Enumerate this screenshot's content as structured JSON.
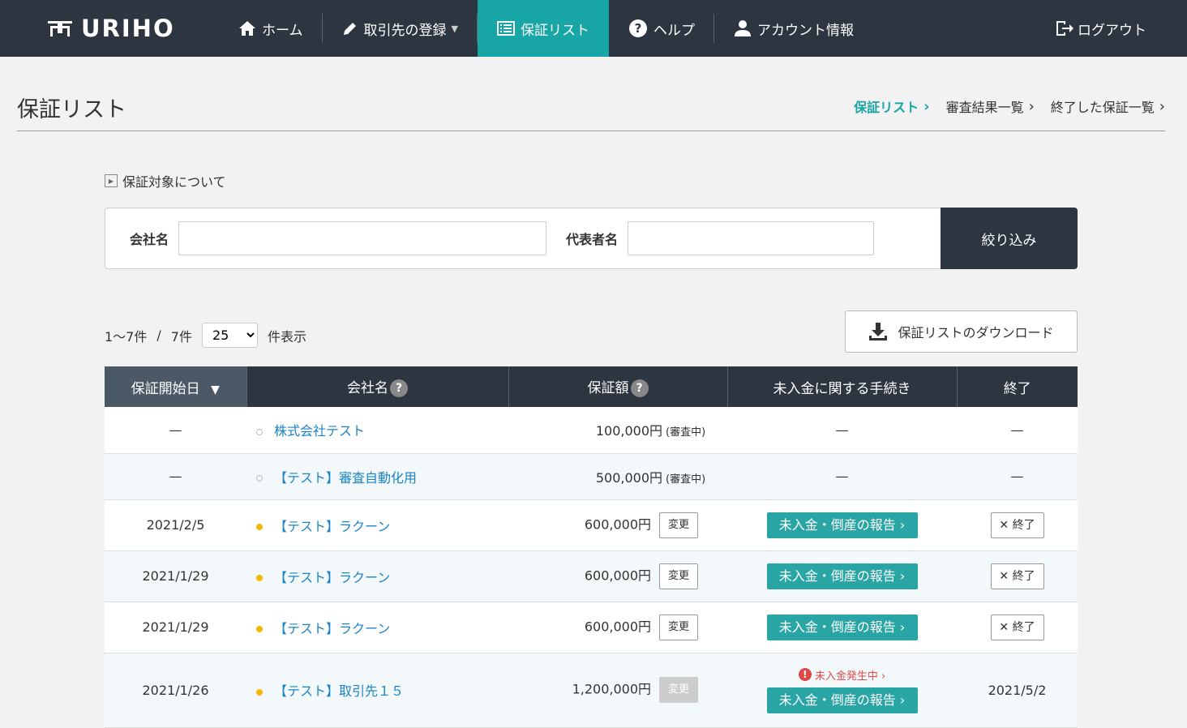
{
  "nav": {
    "logo": "URIHO",
    "items": [
      {
        "label": "ホーム"
      },
      {
        "label": "取引先の登録",
        "caret": "▼"
      },
      {
        "label": "保証リスト"
      },
      {
        "label": "ヘルプ"
      },
      {
        "label": "アカウント情報"
      }
    ],
    "logout": "ログアウト"
  },
  "page": {
    "title": "保証リスト",
    "crumbs": [
      "保証リスト",
      "審査結果一覧",
      "終了した保証一覧"
    ],
    "crumb_chev": "›"
  },
  "about": "保証対象について",
  "filter": {
    "company_label": "会社名",
    "company_value": "",
    "rep_label": "代表者名",
    "rep_value": "",
    "submit": "絞り込み"
  },
  "pagination": {
    "range": "1～7件",
    "sep": "/",
    "total": "7件",
    "per_page": "25",
    "suffix": "件表示"
  },
  "download": "保証リストのダウンロード",
  "table": {
    "headers": [
      "保証開始日",
      "会社名",
      "保証額",
      "未入金に関する手続き",
      "終了"
    ],
    "sort_icon": "▼",
    "help": "?",
    "rows": [
      {
        "date": "—",
        "company": "株式会社テスト",
        "amount": "100,000円",
        "amount_note": "(審査中)",
        "proc": "—",
        "end": "—"
      },
      {
        "date": "—",
        "company": "【テスト】審査自動化用",
        "amount": "500,000円",
        "amount_note": "(審査中)",
        "proc": "—",
        "end": "—"
      },
      {
        "date": "2021/2/5",
        "company": "【テスト】ラクーン",
        "amount": "600,000円",
        "change": "変更",
        "proc_btn": "未入金・倒産の報告 ›",
        "end_btn": "✕ 終了"
      },
      {
        "date": "2021/1/29",
        "company": "【テスト】ラクーン",
        "amount": "600,000円",
        "change": "変更",
        "proc_btn": "未入金・倒産の報告 ›",
        "end_btn": "✕ 終了"
      },
      {
        "date": "2021/1/29",
        "company": "【テスト】ラクーン",
        "amount": "600,000円",
        "change": "変更",
        "proc_btn": "未入金・倒産の報告 ›",
        "end_btn": "✕ 終了"
      },
      {
        "date": "2021/1/26",
        "company": "【テスト】取引先１５",
        "amount": "1,200,000円",
        "change": "変更",
        "unpaid": "未入金発生中 ›",
        "unpaid_icon": "!",
        "proc_btn": "未入金・倒産の報告 ›",
        "end": "2021/5/2"
      }
    ]
  }
}
